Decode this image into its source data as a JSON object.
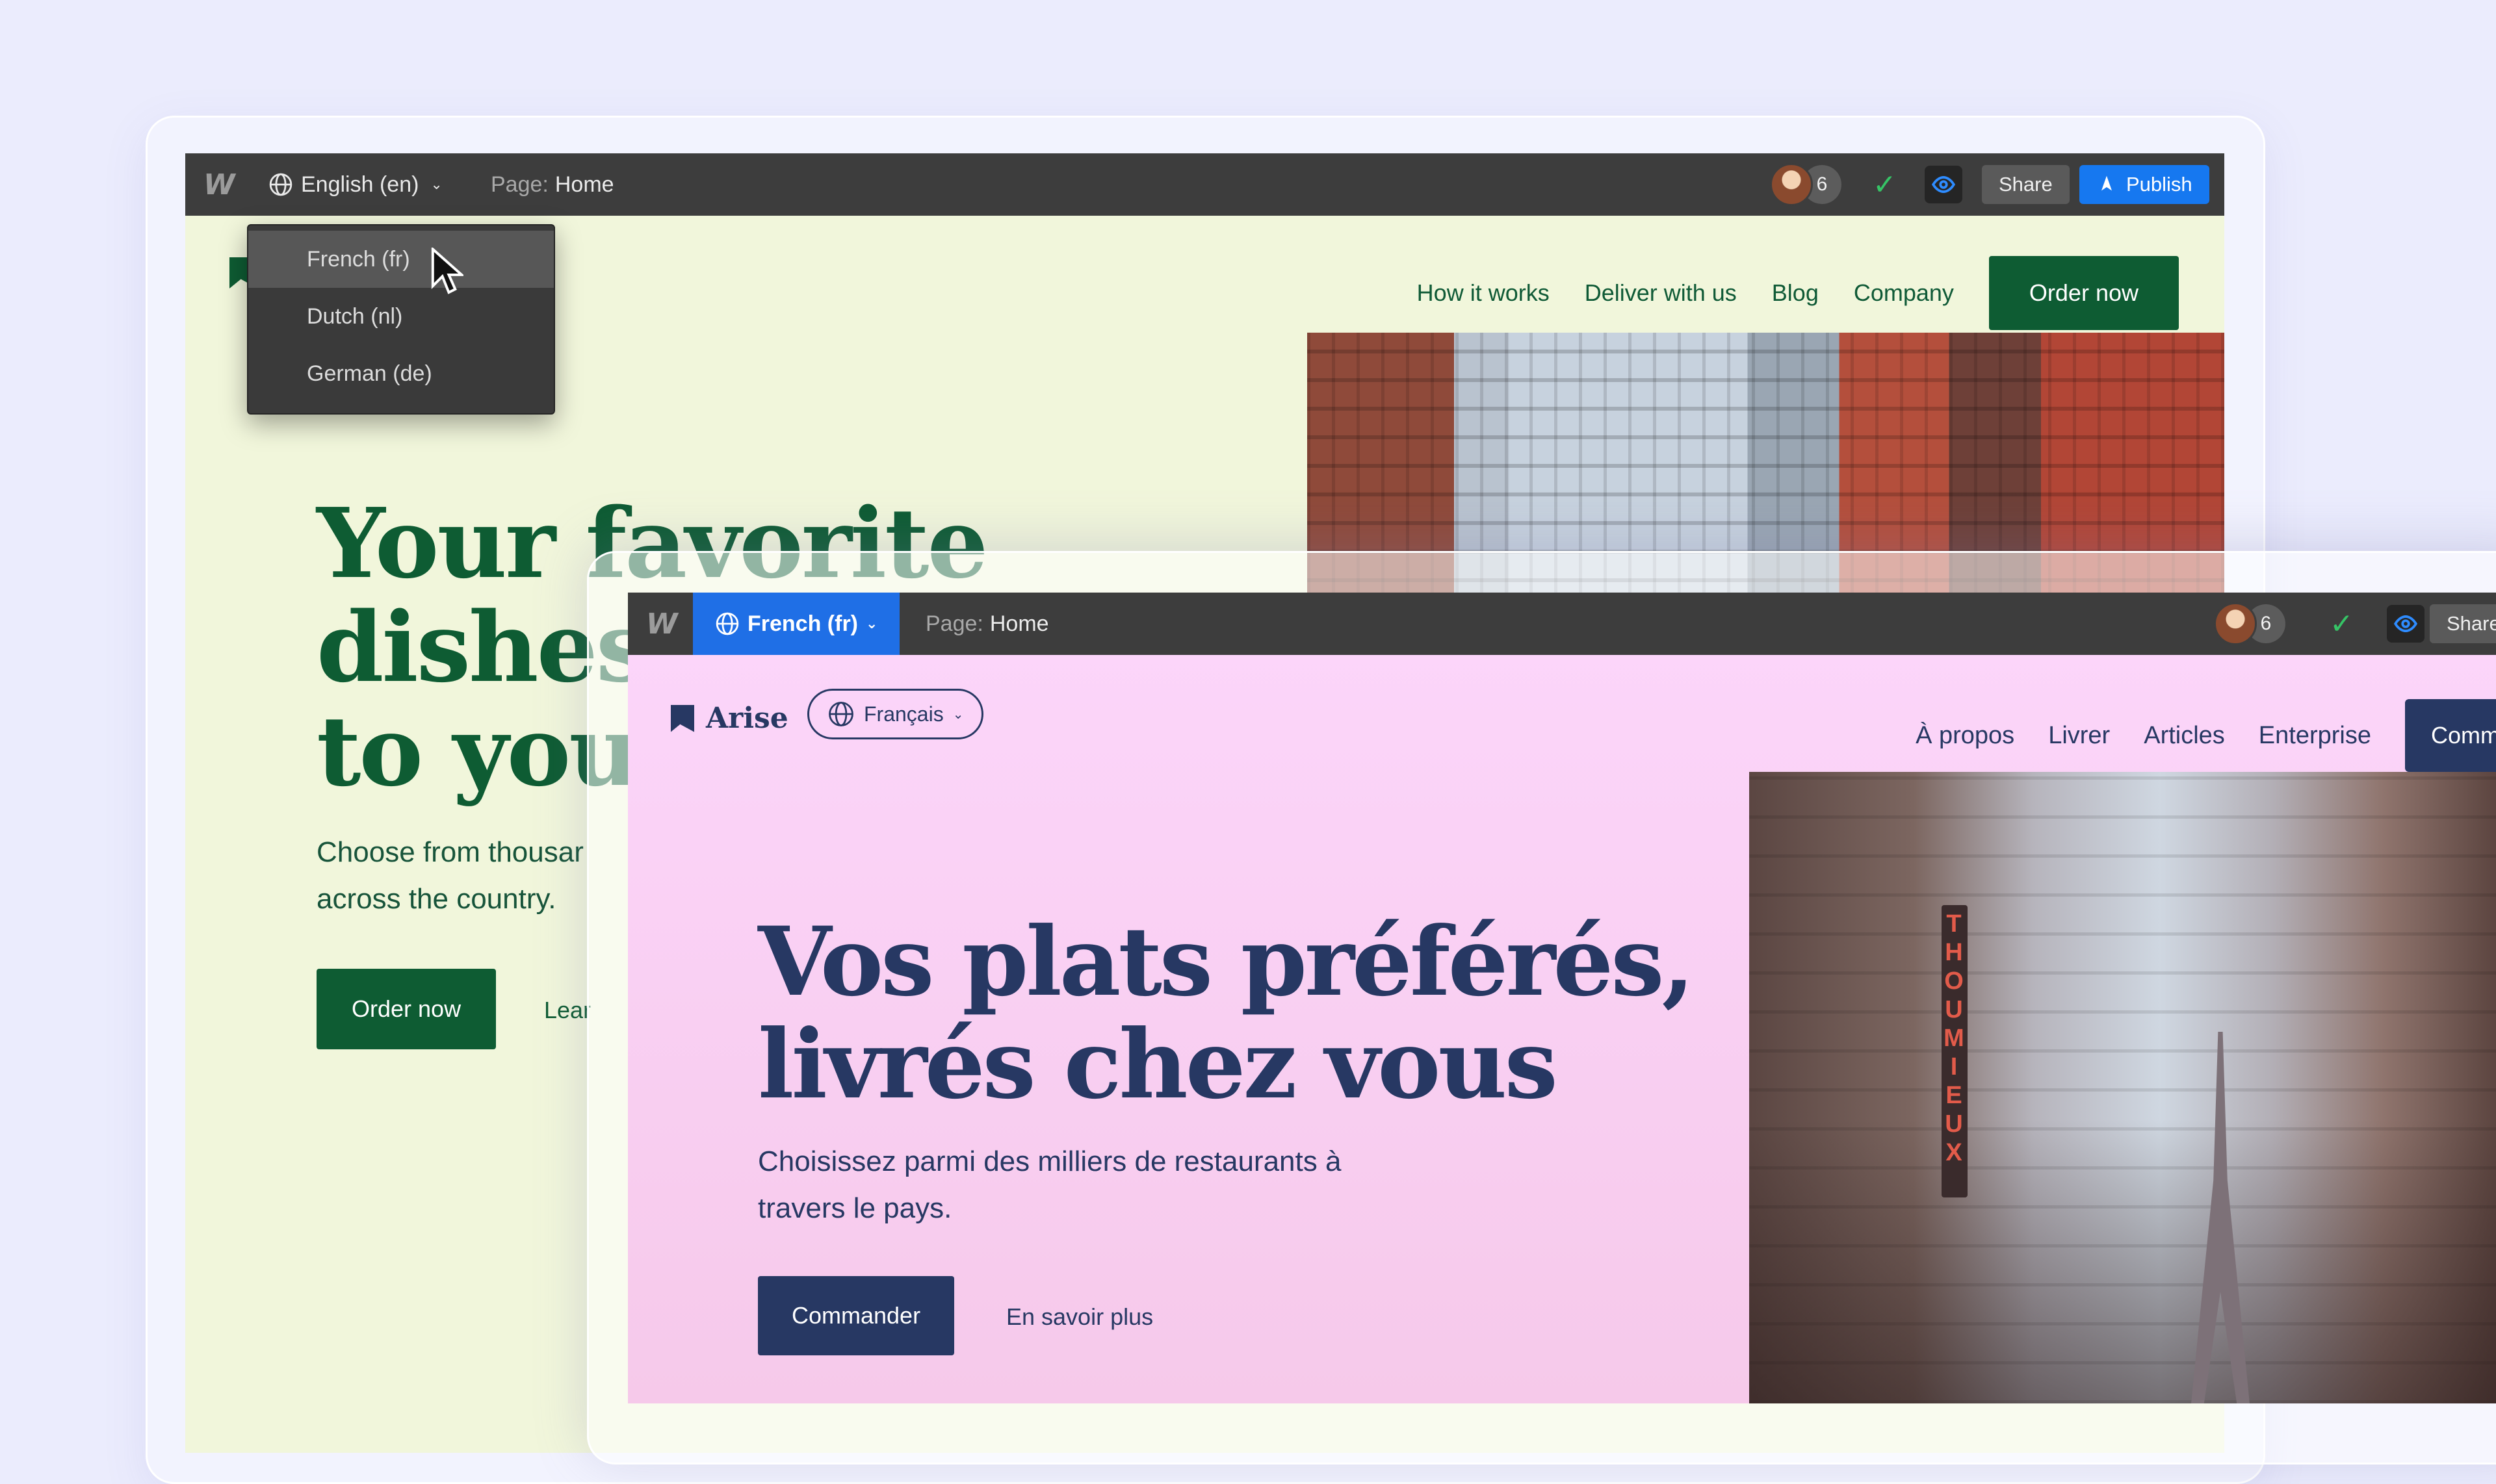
{
  "english_window": {
    "toolbar": {
      "logo": "W",
      "language_button": "English (en)",
      "page_label_key": "Page:",
      "page_label_value": "Home",
      "collaborator_count": "6",
      "share_label": "Share",
      "publish_label": "Publish"
    },
    "language_dropdown": {
      "items": [
        "French (fr)",
        "Dutch (nl)",
        "German (de)"
      ],
      "hovered_item": "French (fr)"
    },
    "site": {
      "nav": [
        "How it works",
        "Deliver with us",
        "Blog",
        "Company"
      ],
      "nav_cta": "Order now",
      "hero_title_lines": [
        "Your favorite",
        "dishes",
        "to your"
      ],
      "hero_sub_lines": [
        "Choose from thousar",
        "across the country."
      ],
      "hero_cta": "Order now",
      "hero_link": "Lear"
    }
  },
  "french_window": {
    "toolbar": {
      "logo": "W",
      "language_button": "French (fr)",
      "page_label_key": "Page:",
      "page_label_value": "Home",
      "collaborator_count": "6",
      "share_label": "Share"
    },
    "site": {
      "brand": "Arise",
      "language_pill": "Français",
      "nav": [
        "À propos",
        "Livrer",
        "Articles",
        "Enterprise"
      ],
      "nav_cta": "Commander",
      "hero_title_lines": [
        "Vos plats préférés,",
        "livrés chez vous"
      ],
      "hero_sub_lines": [
        "Choisissez parmi des milliers de restaurants à",
        "travers le pays."
      ],
      "hero_cta": "Commander",
      "hero_link": "En savoir plus",
      "photo_sign": "THOUMIEUX"
    }
  },
  "colors": {
    "page_bg": "#ebecfd",
    "toolbar_bg": "#3d3d3d",
    "publish_blue": "#1678f0",
    "english_green": "#0e5c33",
    "english_bg": "#f1f6db",
    "french_navy": "#273863",
    "french_bg": "#fcd6fb"
  },
  "icons": {
    "logo": "webflow-w-icon",
    "language": "globe-icon",
    "dropdown": "chevron-down-icon",
    "status": "check-icon",
    "preview": "eye-icon",
    "publish": "rocket-icon"
  }
}
